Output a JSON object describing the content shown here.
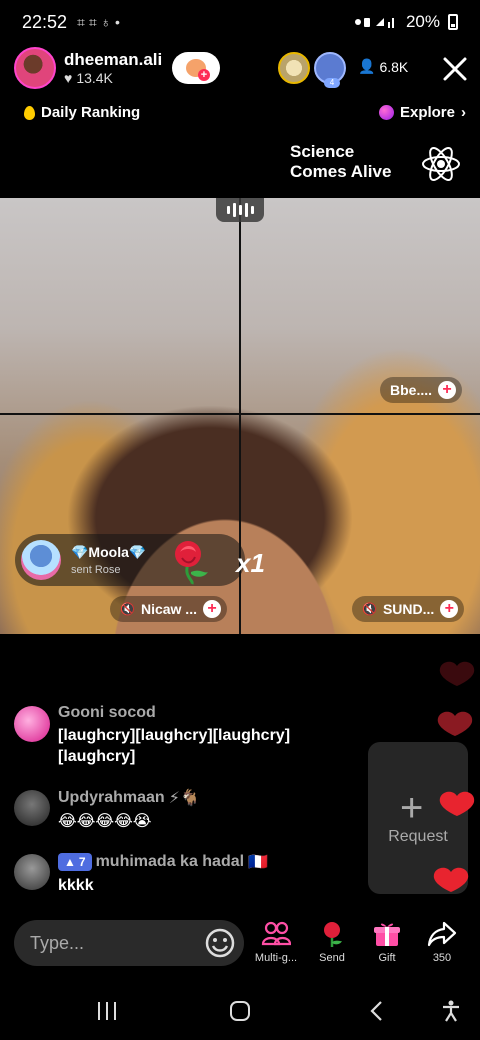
{
  "status_bar": {
    "time": "22:52",
    "sys_icons": "⌗ ⌗ ♁ •",
    "battery": "20%"
  },
  "host": {
    "name": "dheeman.ali",
    "likes": "13.4K"
  },
  "viewers": {
    "count": "6.8K",
    "badge_level": "4"
  },
  "ranking": {
    "daily_label": "Daily Ranking",
    "explore_label": "Explore"
  },
  "promo": {
    "line1": "Science",
    "line2": "Comes Alive"
  },
  "guests": [
    {
      "name": "Bbe...."
    },
    {
      "name": "Nicaw ..."
    },
    {
      "name": "SUND..."
    }
  ],
  "gift": {
    "user": "💎Moola💎",
    "action": "sent Rose",
    "count": "x1"
  },
  "comments": [
    {
      "user": "Gooni socod",
      "text": "[laughcry][laughcry][laughcry] [laughcry]"
    },
    {
      "user": "Updyrahmaan",
      "suffix": "⚡🐐",
      "text": "😂😂😂😂😭"
    },
    {
      "user": "muhimada ka hadal",
      "suffix": "🇫🇷",
      "badge": "7",
      "text": "kkkk"
    }
  ],
  "request": {
    "label": "Request"
  },
  "input": {
    "placeholder": "Type..."
  },
  "actions": [
    {
      "label": "Multi-g..."
    },
    {
      "label": "Send"
    },
    {
      "label": "Gift"
    },
    {
      "label": "350"
    }
  ],
  "colors": {
    "accent": "#fe2c55",
    "heart": "#e8242f",
    "badge": "#4f6de0"
  }
}
